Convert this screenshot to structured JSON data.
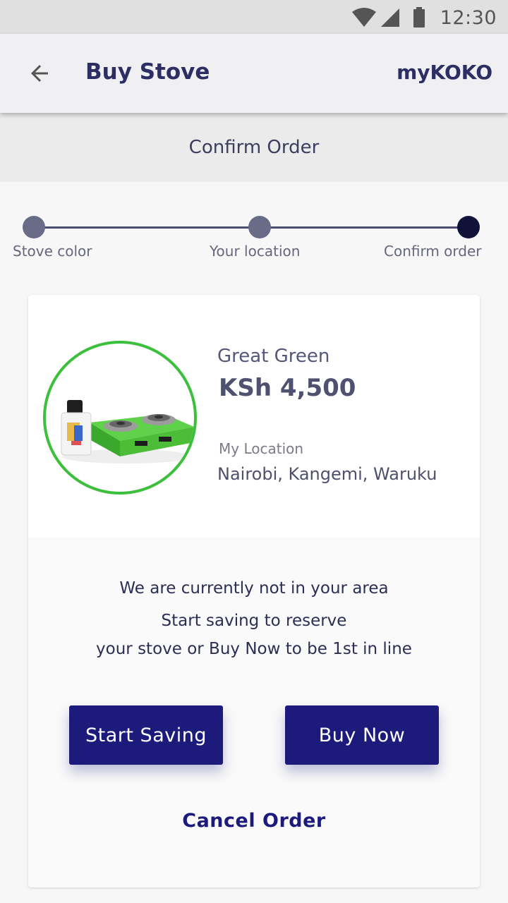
{
  "status_bar": {
    "time": "12:30"
  },
  "app_bar": {
    "title": "Buy Stove",
    "brand": "myKOKO"
  },
  "section": {
    "title": "Confirm Order"
  },
  "stepper": {
    "steps": [
      {
        "label": "Stove color",
        "state": "completed"
      },
      {
        "label": "Your location",
        "state": "completed"
      },
      {
        "label": "Confirm order",
        "state": "current"
      }
    ]
  },
  "product": {
    "name": "Great Green",
    "price": "KSh 4,500",
    "location_label": "My Location",
    "location_value": "Nairobi, Kangemi, Waruku"
  },
  "message": {
    "line1": "We are currently not in your area",
    "line2": "Start saving to reserve",
    "line3": "your stove or Buy Now to be 1st in line"
  },
  "actions": {
    "start_saving": "Start Saving",
    "buy_now": "Buy Now",
    "cancel": "Cancel Order"
  },
  "colors": {
    "primary": "#1c1b7c",
    "accent_green": "#3cbf3c",
    "title_text": "#2d2e63",
    "step_active": "#10123a"
  },
  "icons": {
    "back": "arrow-back-icon",
    "wifi": "wifi-icon",
    "signal": "cell-signal-icon",
    "battery": "battery-icon"
  }
}
